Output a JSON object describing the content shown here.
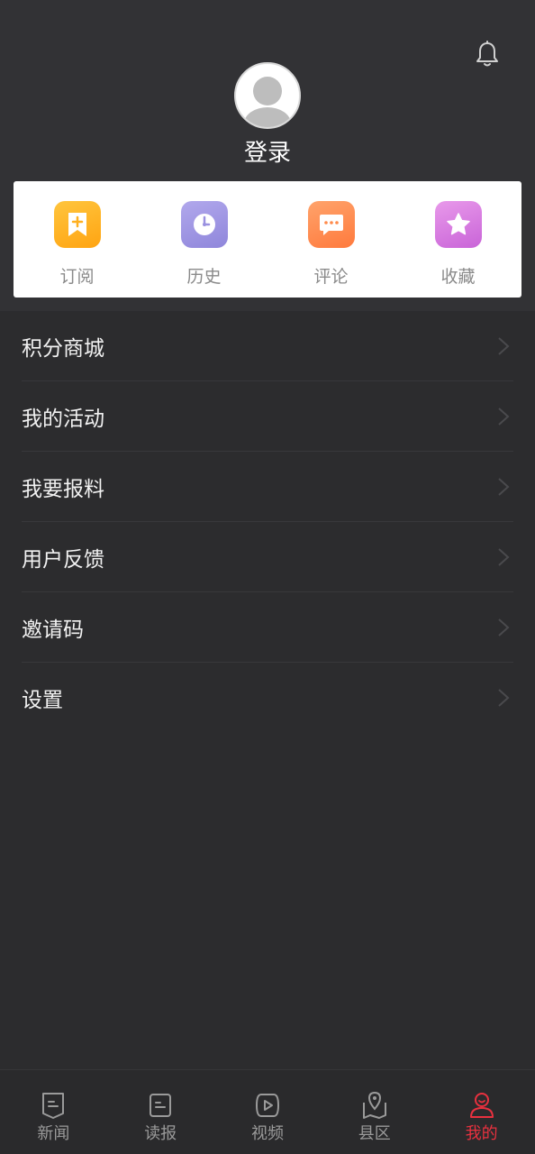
{
  "header": {
    "login_label": "登录"
  },
  "quick_actions": [
    {
      "label": "订阅",
      "icon": "bookmark-plus-icon",
      "color_from": "#ffc53d",
      "color_to": "#ffa412"
    },
    {
      "label": "历史",
      "icon": "clock-icon",
      "color_from": "#b1a8ec",
      "color_to": "#8f86db"
    },
    {
      "label": "评论",
      "icon": "comment-icon",
      "color_from": "#ffa36b",
      "color_to": "#ff7a3d"
    },
    {
      "label": "收藏",
      "icon": "star-icon",
      "color_from": "#e899ea",
      "color_to": "#c964d8"
    }
  ],
  "menu": [
    {
      "label": "积分商城"
    },
    {
      "label": "我的活动"
    },
    {
      "label": "我要报料"
    },
    {
      "label": "用户反馈"
    },
    {
      "label": "邀请码"
    },
    {
      "label": "设置"
    }
  ],
  "tabs": [
    {
      "label": "新闻",
      "icon": "news-icon",
      "active": false
    },
    {
      "label": "读报",
      "icon": "newspaper-icon",
      "active": false
    },
    {
      "label": "视频",
      "icon": "video-icon",
      "active": false
    },
    {
      "label": "县区",
      "icon": "map-pin-icon",
      "active": false
    },
    {
      "label": "我的",
      "icon": "profile-icon",
      "active": true
    }
  ],
  "colors": {
    "accent": "#e8313f",
    "background": "#2c2c2e",
    "header_bg": "#323235"
  }
}
